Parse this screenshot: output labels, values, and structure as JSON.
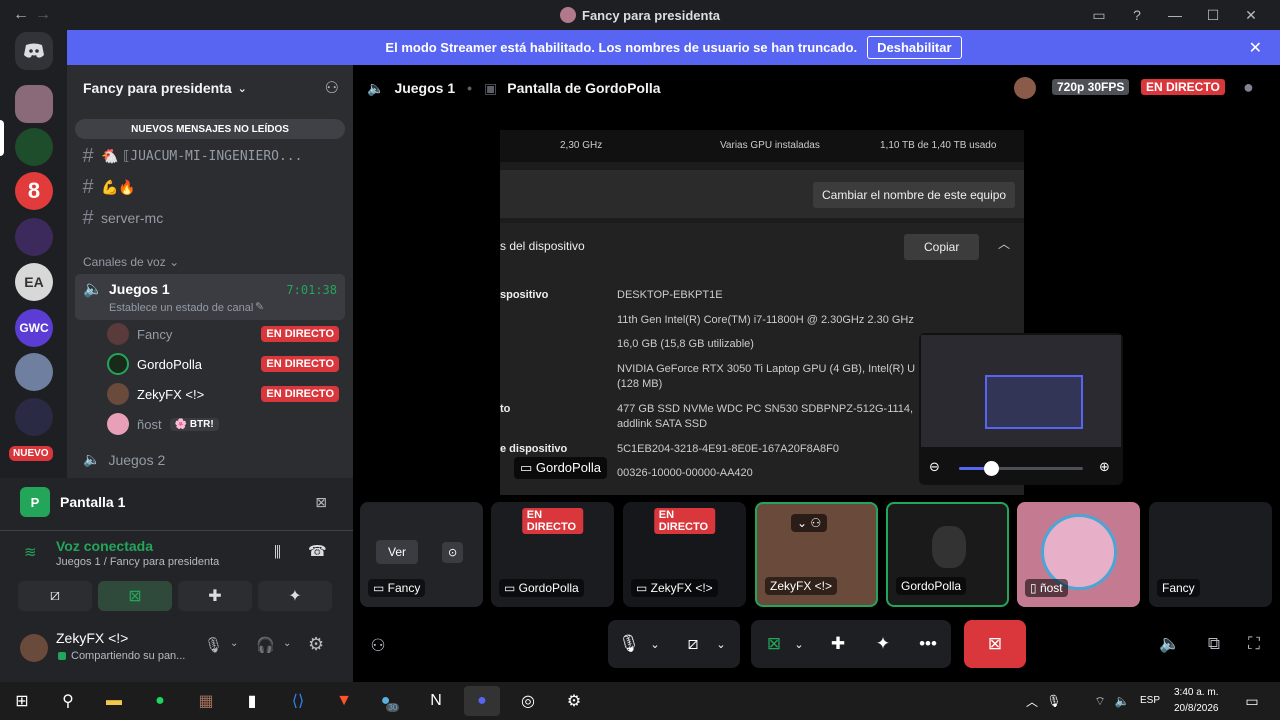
{
  "window": {
    "title": "Fancy para presidenta"
  },
  "banner": {
    "text": "El modo Streamer está habilitado. Los nombres de usuario se han truncado.",
    "button": "Deshabilitar"
  },
  "rail": {
    "new_label": "NUEVO"
  },
  "sidebar": {
    "server_name": "Fancy para presidenta",
    "unread_banner": "NUEVOS MENSAJES NO LEÍDOS",
    "text_channels": [
      "⟦JUACUM-MI-INGENIERO...",
      "💪🔥",
      "server-mc"
    ],
    "voice_category": "Canales de voz",
    "voice_channel": {
      "name": "Juegos 1",
      "timer": "7:01:38",
      "status": "Establece un estado de canal"
    },
    "voice_users": [
      {
        "name": "Fancy",
        "badge": "EN DIRECTO"
      },
      {
        "name": "GordoPolla",
        "badge": "EN DIRECTO"
      },
      {
        "name": "ZekyFX <!>",
        "badge": "EN DIRECTO"
      },
      {
        "name": "ñost",
        "badge": "BTR!"
      }
    ],
    "voice_channel_2": "Juegos 2"
  },
  "panel": {
    "screen_label": "Pantalla 1",
    "voice_status": "Voz conectada",
    "voice_location": "Juegos 1 / Fancy para presidenta",
    "user_name": "ZekyFX <!>",
    "user_status": "Compartiendo su pan..."
  },
  "main": {
    "channel": "Juegos 1",
    "stream_title": "Pantalla de GordoPolla",
    "quality": "720p 30FPS",
    "live_badge": "EN DIRECTO",
    "stream_owner": "GordoPolla"
  },
  "stream_content": {
    "row1": [
      "2,30 GHz",
      "Varias GPU instaladas",
      "1,10 TB de 1,40 TB usado"
    ],
    "rename_button": "Cambiar el nombre de este equipo",
    "section_title": "s del dispositivo",
    "copy_button": "Copiar",
    "labels": [
      "spositivo",
      "to",
      "e dispositivo"
    ],
    "values": [
      "DESKTOP-EBKPT1E",
      "11th Gen Intel(R) Core(TM) i7-11800H @ 2.30GHz   2.30 GHz",
      "16,0 GB (15,8 GB utilizable)",
      "NVIDIA GeForce RTX 3050 Ti Laptop GPU (4 GB), Intel(R) U",
      "(128 MB)",
      "477 GB SSD NVMe WDC PC SN530 SDBPNPZ-512G-1114,",
      "addlink SATA SSD",
      "5C1EB204-3218-4E91-8E0E-167A20F8A8F0",
      "00326-10000-00000-AA420"
    ]
  },
  "tiles": [
    {
      "name": "Fancy",
      "action": "Ver"
    },
    {
      "name": "GordoPolla",
      "badge": "EN DIRECTO"
    },
    {
      "name": "ZekyFX <!>",
      "badge": "EN DIRECTO"
    },
    {
      "name": "ZekyFX <!>"
    },
    {
      "name": "GordoPolla"
    },
    {
      "name": "ñost"
    },
    {
      "name": "Fancy"
    }
  ],
  "taskbar": {
    "lang": "ESP",
    "time": "3:40 a. m.",
    "date": "20/8/2026",
    "badge_vscode": "30"
  },
  "colors": {
    "blurple": "#5865f2",
    "live_red": "#da373c",
    "green": "#23a55a"
  }
}
